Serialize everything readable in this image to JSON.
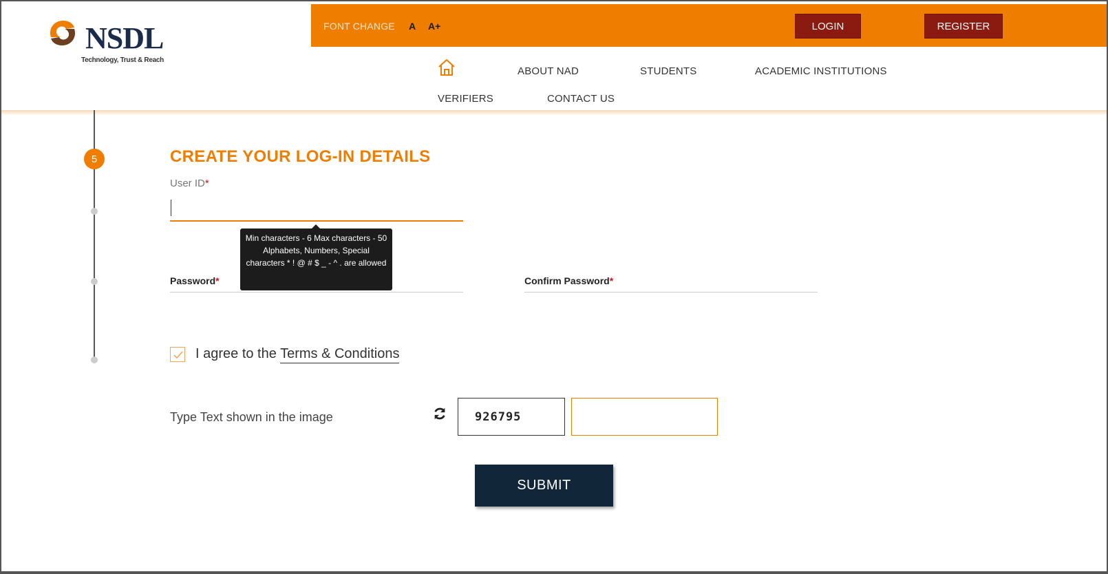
{
  "brand": {
    "name": "NSDL",
    "tagline": "Technology, Trust & Reach",
    "logo_icon": "nsdl-logo-icon"
  },
  "topbar": {
    "font_change_label": "FONT CHANGE",
    "font_small": "A",
    "font_large": "A+",
    "login_label": "LOGIN",
    "register_label": "REGISTER"
  },
  "nav": {
    "home_icon": "home-icon",
    "items": [
      {
        "label": "ABOUT NAD"
      },
      {
        "label": "STUDENTS"
      },
      {
        "label": "ACADEMIC INSTITUTIONS"
      },
      {
        "label": "VERIFIERS"
      },
      {
        "label": "CONTACT US"
      }
    ]
  },
  "steps": {
    "current": "5"
  },
  "form": {
    "title": "CREATE YOUR LOG-IN DETAILS",
    "user_id_label": "User ID",
    "user_id_value": "",
    "required_mark": "*",
    "password_label": "Password",
    "confirm_password_label": "Confirm Password",
    "tooltip": "Min characters - 6 Max characters - 50 Alphabets, Numbers, Special characters * ! @ # $ _ - ^ . are allowed",
    "agree_prefix": "I agree to the",
    "terms_link": "Terms & Conditions",
    "agree_checked": true,
    "captcha_label": "Type Text shown in the image",
    "captcha_text": "926795",
    "captcha_input_value": "",
    "submit_label": "SUBMIT"
  },
  "colors": {
    "accent": "#ee7d00",
    "button_dark_red": "#8b1a10",
    "submit_navy": "#12263a"
  }
}
